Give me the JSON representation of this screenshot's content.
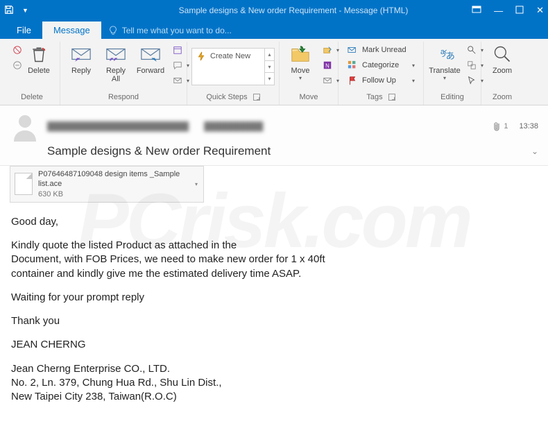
{
  "window": {
    "title": "Sample designs & New order Requirement - Message (HTML)"
  },
  "tabs": {
    "file": "File",
    "message": "Message",
    "tellme": "Tell me what you want to do..."
  },
  "ribbon": {
    "delete": {
      "big": "Delete",
      "group": "Delete"
    },
    "respond": {
      "reply": "Reply",
      "replyall": "Reply\nAll",
      "forward": "Forward",
      "group": "Respond"
    },
    "quicksteps": {
      "create": "Create New",
      "group": "Quick Steps"
    },
    "move": {
      "move": "Move",
      "group": "Move"
    },
    "tags": {
      "unread": "Mark Unread",
      "categorize": "Categorize",
      "followup": "Follow Up",
      "group": "Tags"
    },
    "editing": {
      "translate": "Translate",
      "group": "Editing"
    },
    "zoom": {
      "zoom": "Zoom",
      "group": "Zoom"
    }
  },
  "message": {
    "from_blur1": "████████████████████████",
    "from_blur2": "██████████",
    "attachcount": "1",
    "time": "13:38",
    "subject": "Sample designs & New order Requirement",
    "attachment": {
      "name": "P07646487109048 design items _Sample list.ace",
      "size": "630 KB"
    }
  },
  "body": {
    "p1": "Good day,",
    "p2a": "Kindly quote the listed Product as attached in the",
    "p2b": "Document, with FOB Prices, we need to make new order for 1 x 40ft",
    "p2c": "container and kindly give me the estimated delivery time ASAP.",
    "p3": "Waiting for your prompt reply",
    "p4": "Thank you",
    "p5": "JEAN CHERNG",
    "p6a": "Jean Cherng Enterprise CO., LTD.",
    "p6b": "No. 2, Ln. 379, Chung Hua Rd., Shu Lin Dist.,",
    "p6c": "New Taipei City 238, Taiwan(R.O.C)"
  },
  "watermark": "PCrisk.com"
}
